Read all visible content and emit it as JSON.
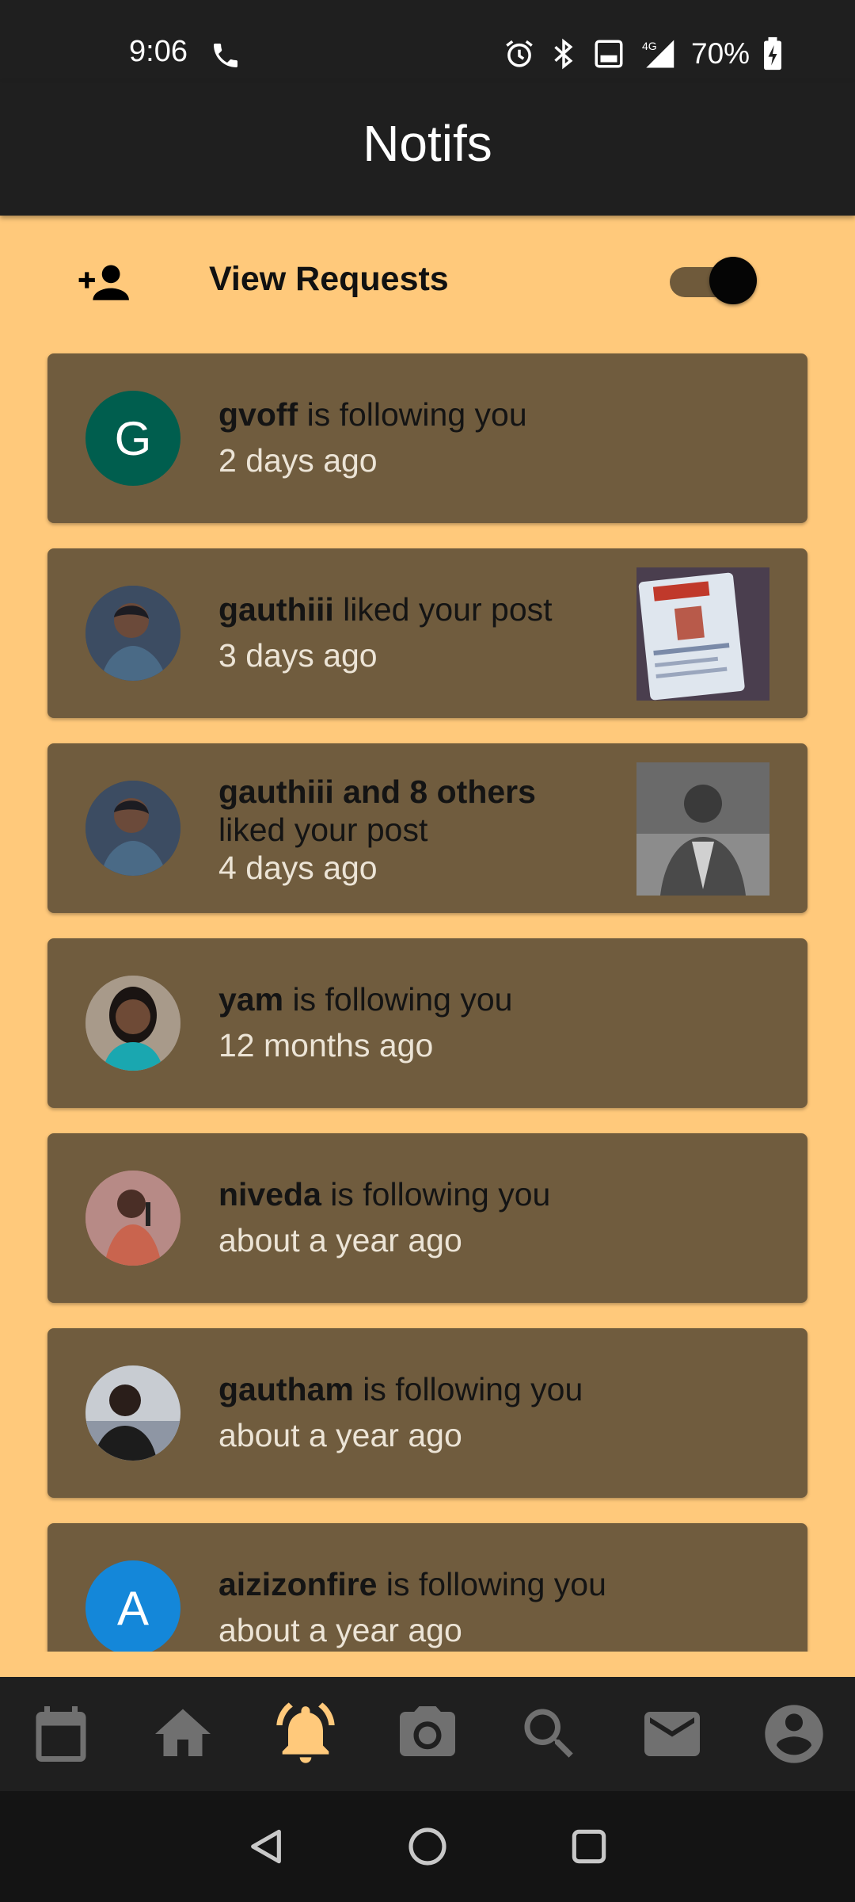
{
  "status_bar": {
    "time": "9:06",
    "battery": "70%",
    "icons": [
      "phone-icon",
      "alarm-icon",
      "bluetooth-icon",
      "volte-icon",
      "signal-4g-icon",
      "battery-charging-icon"
    ]
  },
  "app_bar": {
    "title": "Notifs"
  },
  "requests": {
    "label": "View Requests",
    "icon": "person-add-icon",
    "toggle_on": true
  },
  "colors": {
    "background": "#ffc97b",
    "card": "#705c3e",
    "bar": "#1f1f1f",
    "active_nav": "#ffc97b",
    "inactive_nav": "#707070"
  },
  "notifications": [
    {
      "user": "gvoff",
      "action": " is following you",
      "time": "2 days ago",
      "avatar_letter": "G",
      "avatar_color": "#005e4e",
      "has_post": false
    },
    {
      "user": "gauthiii",
      "action": " liked your post",
      "time": "3 days ago",
      "avatar_letter": "",
      "avatar_color": "#3a4a5e",
      "has_post": true
    },
    {
      "user": "gauthiii and 8 others",
      "action": "liked your post",
      "time": "4 days ago",
      "avatar_letter": "",
      "avatar_color": "#3a4a5e",
      "has_post": true
    },
    {
      "user": "yam",
      "action": " is following you",
      "time": "12 months ago",
      "avatar_letter": "",
      "avatar_color": "#8a7f72",
      "has_post": false
    },
    {
      "user": "niveda",
      "action": " is following you",
      "time": "about a year ago",
      "avatar_letter": "",
      "avatar_color": "#b37a7a",
      "has_post": false
    },
    {
      "user": "gautham",
      "action": " is following you",
      "time": "about a year ago",
      "avatar_letter": "",
      "avatar_color": "#6d7480",
      "has_post": false
    },
    {
      "user": "aizizonfire",
      "action": " is following you",
      "time": "about a year ago",
      "avatar_letter": "A",
      "avatar_color": "#1487d9",
      "has_post": false
    }
  ],
  "bottom_nav": {
    "items": [
      "calendar-icon",
      "home-icon",
      "bell-icon",
      "camera-icon",
      "search-icon",
      "mail-icon",
      "account-icon"
    ],
    "active": "bell-icon"
  },
  "system_nav": [
    "back-icon",
    "home-circle-icon",
    "recents-icon"
  ]
}
